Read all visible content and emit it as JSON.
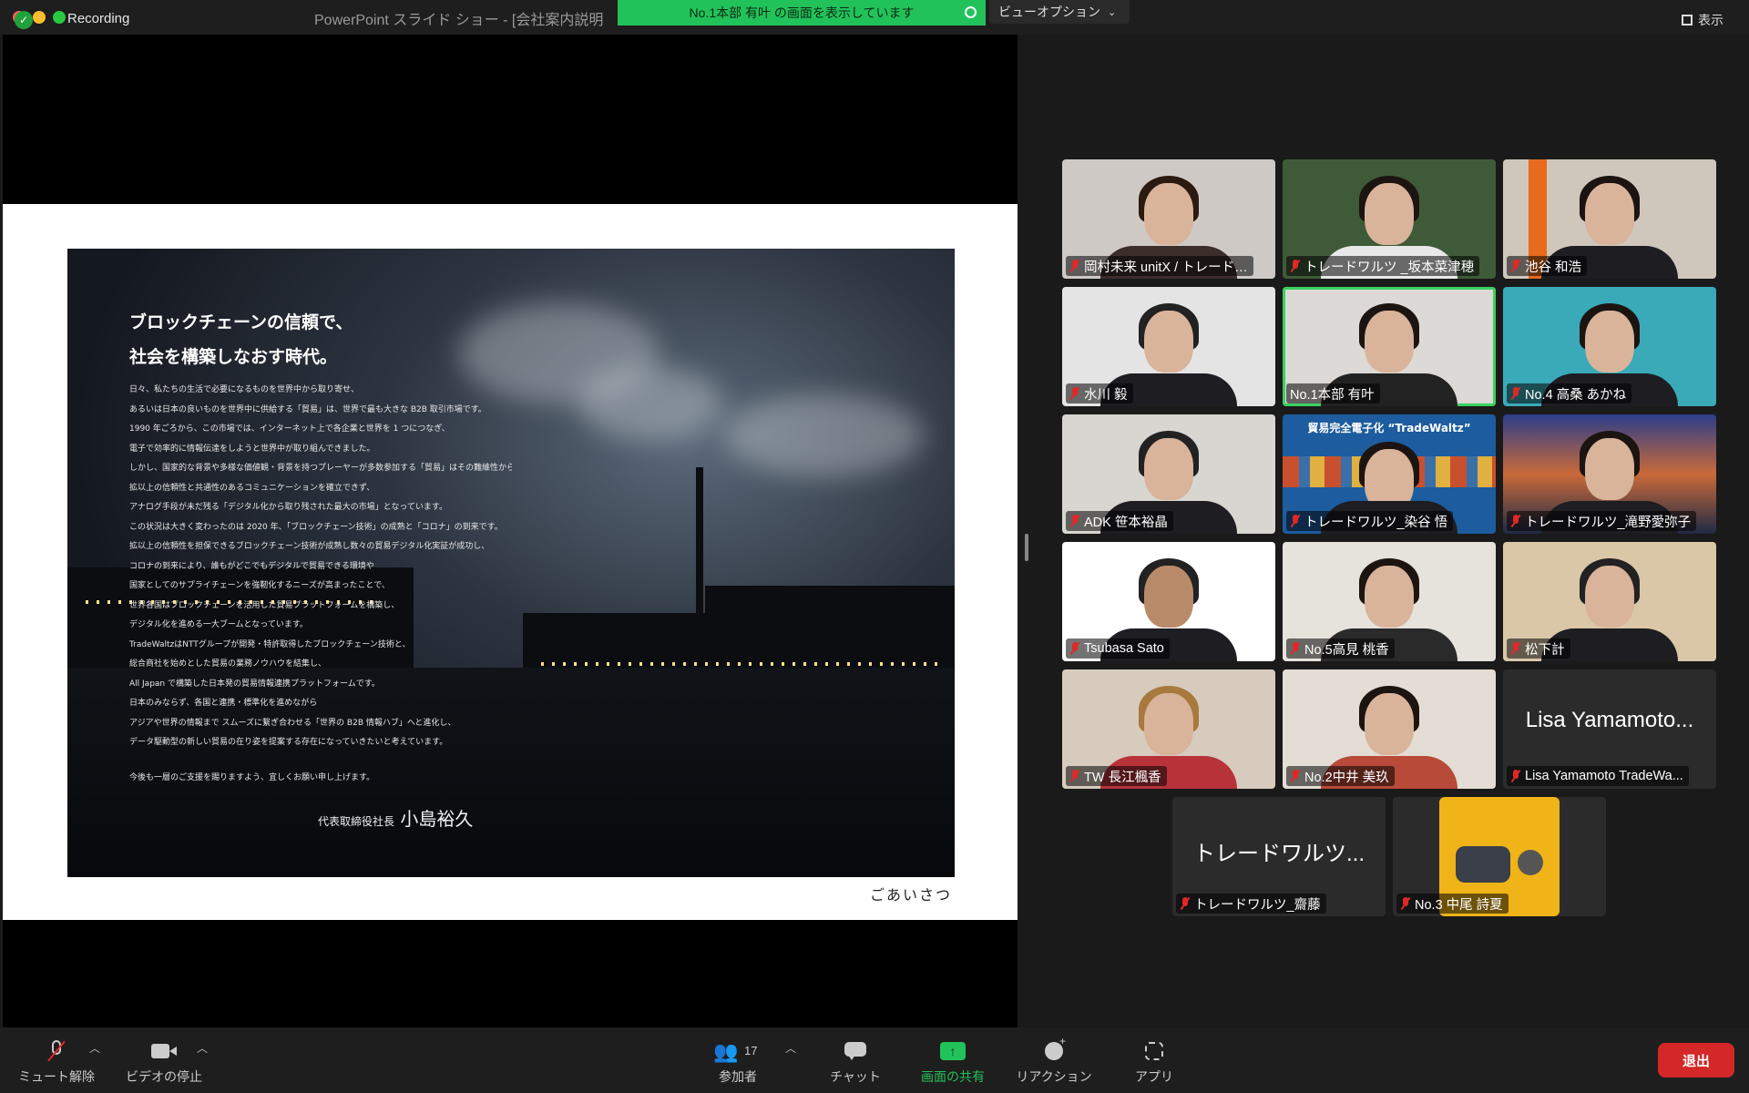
{
  "window": {
    "recording_label": "Recording",
    "title": "PowerPoint スライド ショー - [会社案内説明",
    "share_banner": "No.1本部 有叶 の画面を表示しています",
    "view_options_label": "ビューオプション",
    "view_toggle_label": "表示"
  },
  "slide": {
    "heading_line1": "ブロックチェーンの信頼で、",
    "heading_line2": "社会を構築しなおす時代。",
    "body_lines": [
      "日々、私たちの生活で必要になるものを世界中から取り寄せ、",
      "あるいは日本の良いものを世界中に供給する「貿易」は、世界で最も大きな B2B 取引市場です。",
      "1990 年ごろから、この市場では、インターネット上で各企業と世界を 1 つにつなぎ、",
      "電子で効率的に情報伝達をしようと世界中が取り組んできました。",
      "しかし、国家的な背景や多様な価値観・背景を持つプレーヤーが多数参加する「貿易」はその難維性から、",
      "拡以上の信頼性と共通性のあるコミュニケーションを確立できず、",
      "アナログ手段が未だ残る「デジタル化から取り残された最大の市場」となっています。",
      "この状況は大きく変わったのは 2020 年、「ブロックチェーン技術」の成熟と「コロナ」の到来です。",
      "拡以上の信頼性を担保できるブロックチェーン技術が成熟し数々の貿易デジタル化実証が成功し、",
      "コロナの到来により、誰もがどこでもデジタルで貿易できる環境や",
      "国家としてのサプライチェーンを強靭化するニーズが高まったことで、",
      "世界各国はブロックチェーンを活用した貿易プラットフォームを構築し、",
      "デジタル化を進める一大ブームとなっています。",
      "TradeWaltzはNTTグループが開発・特許取得したブロックチェーン技術と、",
      "総合商社を始めとした貿易の業務ノウハウを結集し、",
      "All Japan で構築した日本発の貿易情報連携プラットフォームです。",
      "日本のみならず、各国と連携・標準化を進めながら",
      "アジアや世界の情報まで スムーズに繋ぎ合わせる「世界の B2B 情報ハブ」へと進化し、",
      "データ駆動型の新しい貿易の在り姿を提案する存在になっていきたいと考えています。"
    ],
    "closing": "今後も一層のご支援を賜りますよう、宜しくお願い申し上げます。",
    "signature_title": "代表取締役社長",
    "signature_name": "小島裕久",
    "footer": "ごあいさつ"
  },
  "participants": [
    {
      "name": "岡村未来 unitX / トレード…",
      "muted": true,
      "kind": "video"
    },
    {
      "name": "トレードワルツ _坂本菜津穂",
      "muted": true,
      "kind": "video"
    },
    {
      "name": "池谷 和浩",
      "muted": true,
      "kind": "video"
    },
    {
      "name": "水川 毅",
      "muted": true,
      "kind": "video"
    },
    {
      "name": "No.1本部 有叶",
      "muted": false,
      "kind": "video",
      "active_speaker": true
    },
    {
      "name": "No.4 高桑 あかね",
      "muted": true,
      "kind": "video"
    },
    {
      "name": "ADK 笹本裕晶",
      "muted": true,
      "kind": "video"
    },
    {
      "name": "トレードワルツ_染谷 悟",
      "muted": true,
      "kind": "video",
      "banner": "貿易完全電子化 “TradeWaltz”"
    },
    {
      "name": "トレードワルツ_滝野愛弥子",
      "muted": true,
      "kind": "video"
    },
    {
      "name": "Tsubasa Sato",
      "muted": true,
      "kind": "video"
    },
    {
      "name": "No.5高見 桃香",
      "muted": true,
      "kind": "video"
    },
    {
      "name": "松下計",
      "muted": true,
      "kind": "video"
    },
    {
      "name": "TW 長江楓香",
      "muted": true,
      "kind": "video"
    },
    {
      "name": "No.2中井 美玖",
      "muted": true,
      "kind": "video"
    },
    {
      "name": "Lisa Yamamoto TradeWa...",
      "muted": true,
      "kind": "name",
      "display": "Lisa Yamamoto..."
    },
    {
      "name": "トレードワルツ_齋藤",
      "muted": true,
      "kind": "name",
      "display": "トレードワルツ..."
    },
    {
      "name": "No.3 中尾 詩夏",
      "muted": true,
      "kind": "image"
    }
  ],
  "toolbar": {
    "unmute": "ミュート解除",
    "stop_video": "ビデオの停止",
    "participants": "参加者",
    "participant_count": "17",
    "chat": "チャット",
    "share_screen": "画面の共有",
    "reactions": "リアクション",
    "apps": "アプリ",
    "leave": "退出"
  },
  "colors": {
    "share_green": "#22c25a",
    "active_outline": "#3ad15d",
    "leave_red": "#d42727",
    "muted_red": "#e02828"
  }
}
